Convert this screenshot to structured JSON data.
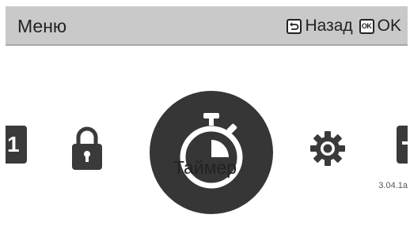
{
  "header": {
    "title": "Меню",
    "back_icon": "back-arrow-icon",
    "back_label": "Назад",
    "ok_key_text": "OK",
    "ok_label": "OK"
  },
  "menu": {
    "left_edge_text": "1",
    "items": [
      {
        "icon": "lock-icon",
        "selected": false
      },
      {
        "icon": "stopwatch-icon",
        "selected": true
      },
      {
        "icon": "gear-icon",
        "selected": false
      }
    ],
    "selected_label": "Таймер"
  },
  "footer": {
    "version": "3.04.1a"
  },
  "colors": {
    "header_bg": "#c9c9c9",
    "icon_dark": "#363636",
    "text": "#222222"
  }
}
